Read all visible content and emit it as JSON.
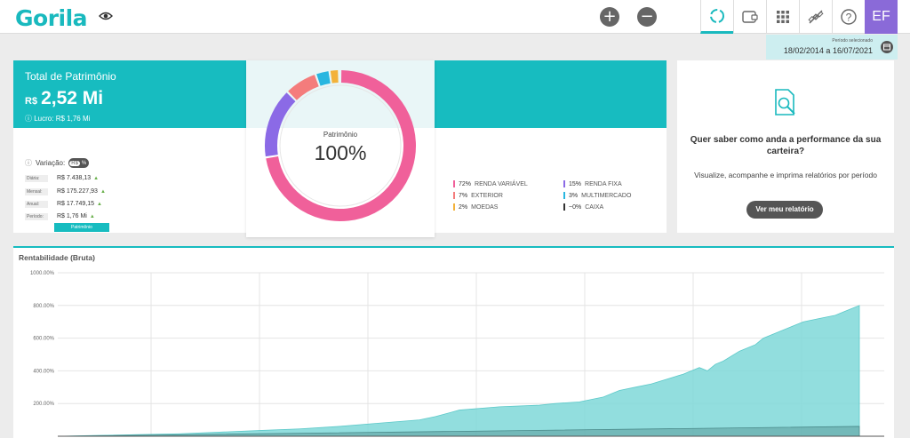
{
  "app": {
    "logo": "Gorila",
    "avatar_initials": "EF"
  },
  "toolbar": {
    "add_label": "+",
    "remove_label": "−",
    "nav_icons": [
      "refresh-icon",
      "wallet-icon",
      "grid-icon",
      "satellite-icon",
      "help-icon"
    ]
  },
  "period": {
    "label": "Período selecionado",
    "value": "18/02/2014 a 16/07/2021"
  },
  "summary": {
    "title": "Total de Patrimônio",
    "currency": "R$",
    "value": "2,52 Mi",
    "lucro_label": "Lucro:",
    "lucro_value": "R$ 1,76 Mi",
    "variacao_label": "Variação:",
    "toggle": [
      "R$",
      "%"
    ],
    "rows": [
      {
        "label": "Diária:",
        "value": "R$ 7.438,13"
      },
      {
        "label": "Mensal:",
        "value": "R$ 175.227,93"
      },
      {
        "label": "Anual:",
        "value": "R$ 17.749,15"
      },
      {
        "label": "Período:",
        "value": "R$ 1,76 Mi"
      }
    ],
    "tab_label": "Patrimônio"
  },
  "donut": {
    "label": "Patrimônio",
    "percent": "100%",
    "segments": [
      {
        "pct": 72,
        "color": "#f0609a"
      },
      {
        "pct": 15,
        "color": "#8b6ae6"
      },
      {
        "pct": 7,
        "color": "#f47c7c"
      },
      {
        "pct": 3,
        "color": "#29b6e0"
      },
      {
        "pct": 2,
        "color": "#f3b23a"
      },
      {
        "pct": 0.3,
        "color": "#333333"
      }
    ]
  },
  "legend": [
    {
      "pct": "72%",
      "name": "RENDA VARIÁVEL",
      "color": "#f0609a"
    },
    {
      "pct": "15%",
      "name": "RENDA FIXA",
      "color": "#8b6ae6"
    },
    {
      "pct": "7%",
      "name": "EXTERIOR",
      "color": "#f47c7c"
    },
    {
      "pct": "3%",
      "name": "MULTIMERCADO",
      "color": "#29b6e0"
    },
    {
      "pct": "2%",
      "name": "MOEDAS",
      "color": "#f3b23a"
    },
    {
      "pct": "~0%",
      "name": "CAIXA",
      "color": "#333333"
    }
  ],
  "report": {
    "title": "Quer saber como anda a performance da sua carteira?",
    "subtitle": "Visualize, acompanhe e imprima relatórios por período",
    "button": "Ver meu relatório"
  },
  "chart_data": {
    "type": "area",
    "title": "Rentabilidade (Bruta)",
    "y_ticks": [
      "1000.00%",
      "800.00%",
      "600.00%",
      "400.00%",
      "200.00%"
    ],
    "ylim": [
      0,
      1000
    ],
    "grid": true,
    "series": [
      {
        "color": "#7fd8d8",
        "x": [
          0,
          0.05,
          0.1,
          0.15,
          0.2,
          0.25,
          0.3,
          0.35,
          0.4,
          0.45,
          0.47,
          0.5,
          0.55,
          0.6,
          0.62,
          0.65,
          0.68,
          0.7,
          0.72,
          0.74,
          0.76,
          0.78,
          0.8,
          0.81,
          0.82,
          0.83,
          0.85,
          0.87,
          0.88,
          0.9,
          0.92,
          0.93,
          0.95,
          0.97,
          0.98,
          0.99,
          1.0
        ],
        "y": [
          0,
          5,
          10,
          15,
          25,
          35,
          45,
          60,
          80,
          100,
          120,
          160,
          180,
          190,
          200,
          210,
          240,
          280,
          300,
          320,
          350,
          380,
          420,
          400,
          440,
          460,
          520,
          560,
          600,
          640,
          680,
          700,
          720,
          740,
          760,
          780,
          800
        ]
      },
      {
        "color": "#5a9a9a",
        "x": [
          0,
          1
        ],
        "y": [
          0,
          60
        ]
      }
    ]
  }
}
